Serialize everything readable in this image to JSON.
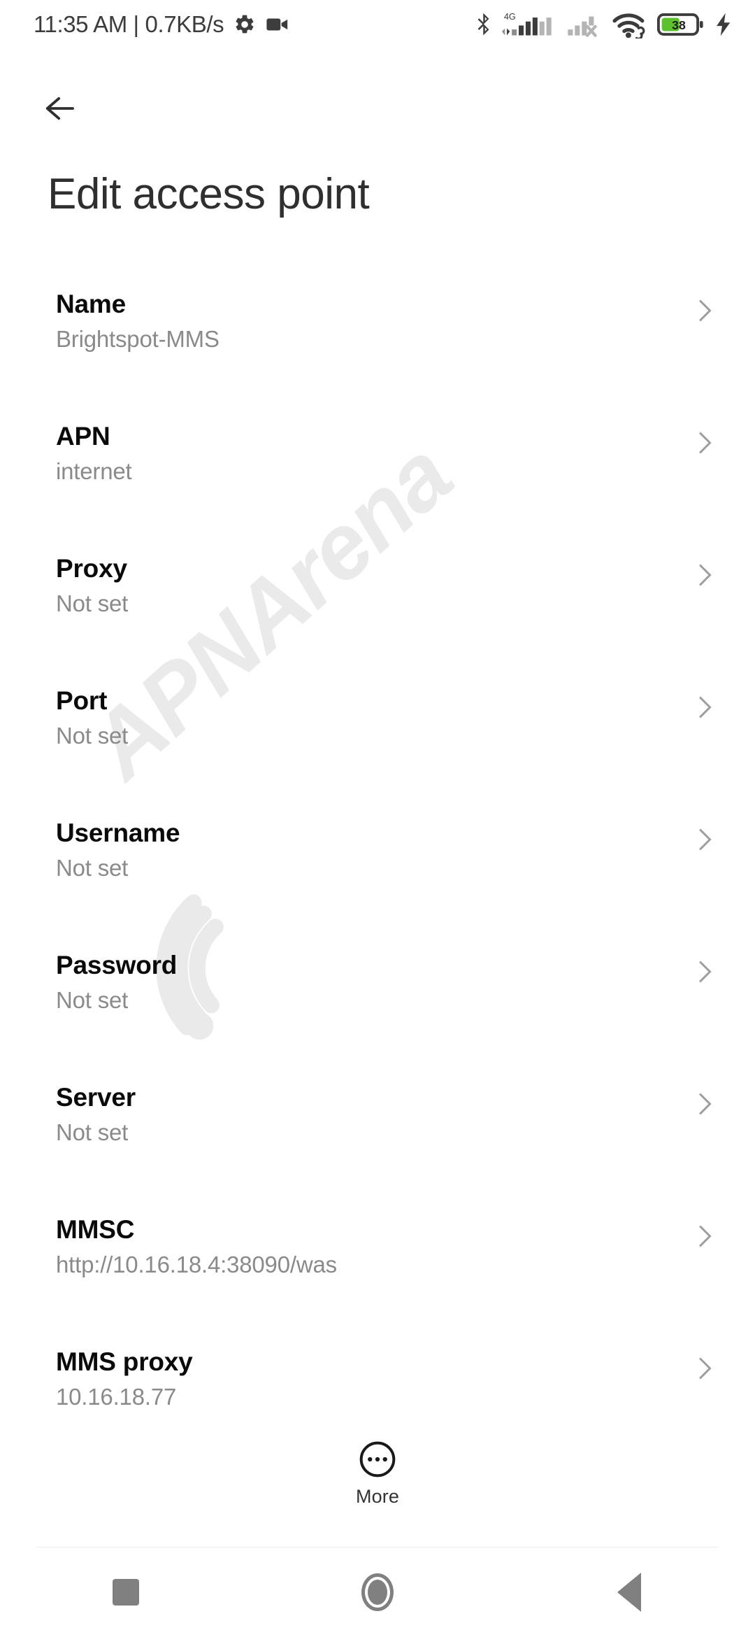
{
  "status_bar": {
    "clock": "11:35 AM | 0.7KB/s",
    "gear_icon": "gear-icon",
    "camcorder_icon": "camcorder-icon",
    "bluetooth_icon": "bluetooth-icon",
    "network_type": "4G",
    "sim1_icon": "signal-bars-sim1-icon",
    "sim2_icon": "signal-bars-sim2-no-service-icon",
    "wifi_icon": "wifi-icon",
    "vpn_link_icon": "vpn-link-icon",
    "battery_level": "38",
    "battery_charging_icon": "charging-bolt-icon",
    "battery_fill_color": "#5bc22e",
    "icon_color": "#3c3c3c"
  },
  "app_bar": {
    "back_icon": "back-arrow-icon",
    "title": "Edit access point"
  },
  "list": {
    "chevron_icon": "chevron-right-icon",
    "rows": [
      {
        "title": "Name",
        "value": "Brightspot-MMS"
      },
      {
        "title": "APN",
        "value": "internet"
      },
      {
        "title": "Proxy",
        "value": "Not set"
      },
      {
        "title": "Port",
        "value": "Not set"
      },
      {
        "title": "Username",
        "value": "Not set"
      },
      {
        "title": "Password",
        "value": "Not set"
      },
      {
        "title": "Server",
        "value": "Not set"
      },
      {
        "title": "MMSC",
        "value": "http://10.16.18.4:38090/was"
      },
      {
        "title": "MMS proxy",
        "value": "10.16.18.77"
      }
    ]
  },
  "more": {
    "icon": "more-dots-circle-icon",
    "label": "More"
  },
  "watermark": {
    "text": "APNArena",
    "logo": "wifi-arc-logo",
    "color": "#eaeaea"
  },
  "nav_bar": {
    "recents_icon": "recents-square-icon",
    "home_icon": "home-circle-icon",
    "back_icon": "back-triangle-icon",
    "color": "#808080"
  }
}
